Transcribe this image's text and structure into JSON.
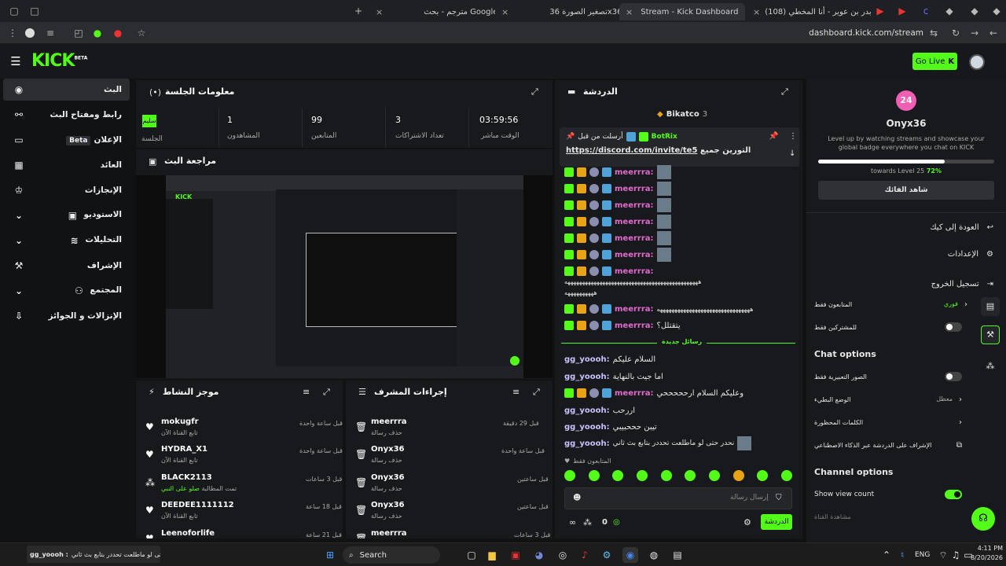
{
  "browser": {
    "tabs": [
      {
        "title": "مترجم - بحث Google"
      },
      {
        "title": "تصغير الصورة 36x36"
      },
      {
        "title": "Stream - Kick Dashboard"
      },
      {
        "title": "(108) بدر بن عوير - أنا المخطي"
      }
    ],
    "url": "dashboard.kick.com/stream"
  },
  "header": {
    "logo": "KICK",
    "logo_sup": "BETA",
    "go_live": "Go Live"
  },
  "sidebar": {
    "items": [
      {
        "label": "البث",
        "icon": "stream-icon"
      },
      {
        "label": "رابط ومفتاح البث",
        "icon": "link-icon"
      },
      {
        "label": "الإعلان",
        "badge": "Beta",
        "icon": "ad-icon"
      },
      {
        "label": "العائد",
        "icon": "revenue-icon"
      },
      {
        "label": "الإنجازات",
        "icon": "trophy-icon"
      },
      {
        "label": "الاستوديو",
        "icon": "studio-icon"
      },
      {
        "label": "التحليلات",
        "icon": "analytics-icon"
      },
      {
        "label": "الإشراف",
        "icon": "moderation-icon"
      },
      {
        "label": "المجتمع",
        "icon": "community-icon"
      },
      {
        "label": "الإنزالات و الجوائز",
        "icon": "drops-icon"
      }
    ]
  },
  "session": {
    "title": "معلومات الجلسة",
    "status_badge": "سليم",
    "session_label": "الجلسة",
    "stats": [
      {
        "value": "1",
        "label": "المشاهدون"
      },
      {
        "value": "99",
        "label": "المتابعين"
      },
      {
        "value": "3",
        "label": "تعداد الاشتراكات"
      },
      {
        "value": "03:59:56",
        "label": "الوقت مباشر"
      }
    ]
  },
  "preview": {
    "title": "مراجعة البث"
  },
  "activity": {
    "title": "موجز النشاط",
    "rows": [
      {
        "name": "mokugfr",
        "sub": "تابع القناة الآن",
        "time": "قبل ساعة واحدة"
      },
      {
        "name": "HYDRA_X1",
        "sub": "تابع القناة الآن",
        "time": "قبل ساعة واحدة"
      },
      {
        "name": "BLACK2113",
        "sub": "تمت المطالبة",
        "sub2": "صلو على النبي",
        "time": "قبل 3 ساعات"
      },
      {
        "name": "DEEDEE1111112",
        "sub": "تابع القناة الآن",
        "time": "قبل 18 ساعة"
      },
      {
        "name": "Leenoforlife",
        "sub": "",
        "time": "قبل 21 ساعة"
      }
    ]
  },
  "modactions": {
    "title": "إجراءات المشرف",
    "rows": [
      {
        "name": "meerrra",
        "sub": "حذف رسالة",
        "time": "قبل 29 دقيقة"
      },
      {
        "name": "Onyx36",
        "sub": "حذف رسالة",
        "time": "قبل ساعة واحدة"
      },
      {
        "name": "Onyx36",
        "sub": "حذف رسالة",
        "time": "قبل ساعتين"
      },
      {
        "name": "Onyx36",
        "sub": "حذف رسالة",
        "time": "قبل ساعتين"
      },
      {
        "name": "meerrra",
        "sub": "",
        "time": "قبل 3 ساعات"
      }
    ]
  },
  "chat": {
    "title": "الدردشة",
    "gifter": "Bikatco",
    "gifter_count": "3",
    "pinned_by": "أرسلت من قبل",
    "pinned_user": "BotRix",
    "pinned_link": "https://discord.com/invite/te5",
    "pinned_text": "التورين جميع",
    "messages": [
      {
        "user": "meerrra:",
        "text": ""
      },
      {
        "user": "meerrra:",
        "text": ""
      },
      {
        "user": "meerrra:",
        "text": ""
      },
      {
        "user": "meerrra:",
        "text": ""
      },
      {
        "user": "meerrra:",
        "text": ""
      },
      {
        "user": "meerrra:",
        "text": ""
      },
      {
        "user": "meerrra:",
        "text": ""
      }
    ],
    "long1": "ههههههههههههههههههههههههههههههههههههههههههههههه",
    "long2": "ههههههههههه",
    "m8_user": "meerrra:",
    "m8_text": "ههههههههههههههههههههههههههههههههه",
    "m9_user": "meerrra:",
    "m9_text": "يتقتلل؟",
    "new_messages": "رسائل جديدة",
    "gg_messages": [
      {
        "user": "gg_yoooh:",
        "text": "السلام عليكم"
      },
      {
        "user": "gg_yoooh:",
        "text": "اما جيت بالنهاية"
      },
      {
        "user": "meerrra:",
        "text": "وعليكم السلام ارحححححي"
      },
      {
        "user": "gg_yoooh:",
        "text": "اررحب"
      },
      {
        "user": "gg_yoooh:",
        "text": "تيبن حححبيبي"
      },
      {
        "user": "gg_yoooh:",
        "text": "نحدر حتى لو ماطلعت تحددر بتابع بث ثاني"
      }
    ],
    "followers_only": "المتابعون فقط",
    "input_placeholder": "إرسال رسالة",
    "count": "0",
    "send_button": "الدردشة"
  },
  "right": {
    "level_badge": "24",
    "username": "Onyx36",
    "desc": "Level up by watching streams and showcase your global badge everywhere you chat on KICK",
    "progress_label": "towards Level 25",
    "progress_pct": "72%",
    "progress_value": 0.72,
    "watch_button": "شاهد الفائك",
    "back_to_kick": "العودة إلى كيك",
    "settings": "الإعدادات",
    "logout": "تسجيل الخروج",
    "followers_only": "المتابعون فقط",
    "followers_val": "فوري",
    "subs_only": "للمشتركين فقط",
    "chat_options": "Chat options",
    "emote_only": "الصور التعبيرية فقط",
    "slow_mode": "الوضع البطيء",
    "slow_val": "معطل",
    "banned_words": "الكلمات المحظورة",
    "ai_moderation": "الإشراف على الدردشة عبر الذكاء الاصطناعي",
    "channel_options": "Channel options",
    "show_view_count": "Show view count",
    "channel_watch": "مشاهدة القناة"
  },
  "taskbar": {
    "search": "Search",
    "lang": "ENG",
    "time": "4:11 PM",
    "date": "8/20/2026",
    "notif": "gg_yoooh :",
    "notif_text": "نحدر حتى لو ماطلعت تحددر بتابع بث ثاني"
  },
  "colors": {
    "accent": "#53fc18",
    "bg": "#111214",
    "panel": "#18191c"
  }
}
